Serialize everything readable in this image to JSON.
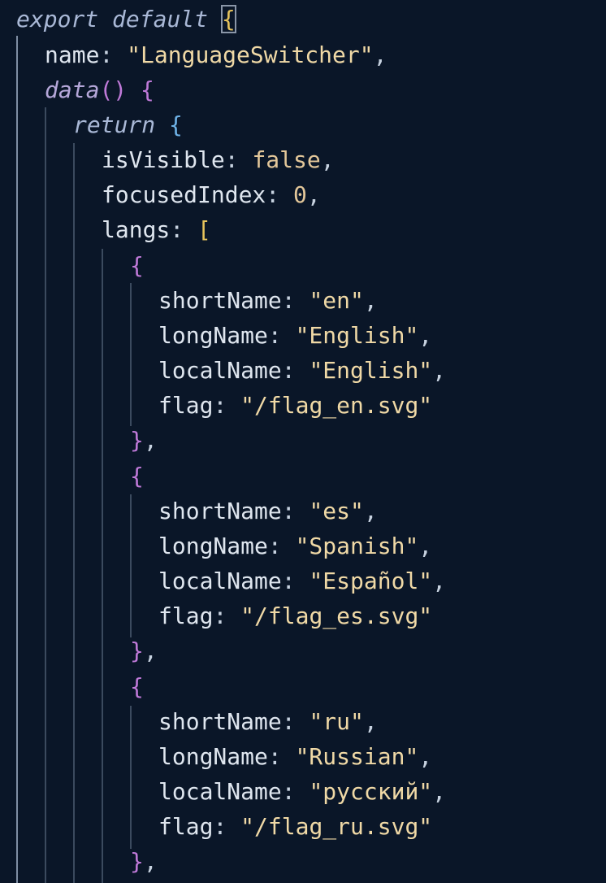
{
  "editor": {
    "theme": {
      "background": "#0a1628",
      "string_color": "#f0d9a6",
      "keyword_color": "#a9b8d6",
      "property_color": "#dfe6ef",
      "bracket_yellow": "#e6c35c",
      "bracket_purple": "#c07ad9",
      "bracket_blue": "#6fb3e8"
    },
    "code": {
      "export_kw": "export",
      "default_kw": "default",
      "open_brace": "{",
      "name_key": "name",
      "name_value": "\"LanguageSwitcher\"",
      "data_fn": "data",
      "data_parens": "()",
      "return_kw": "return",
      "is_visible_key": "isVisible",
      "is_visible_value": "false",
      "focused_index_key": "focusedIndex",
      "focused_index_value": "0",
      "langs_key": "langs",
      "langs_open": "[",
      "langs": [
        {
          "short_key": "shortName",
          "short_value": "\"en\"",
          "long_key": "longName",
          "long_value": "\"English\"",
          "local_key": "localName",
          "local_value": "\"English\"",
          "flag_key": "flag",
          "flag_value": "\"/flag_en.svg\""
        },
        {
          "short_key": "shortName",
          "short_value": "\"es\"",
          "long_key": "longName",
          "long_value": "\"Spanish\"",
          "local_key": "localName",
          "local_value": "\"Español\"",
          "flag_key": "flag",
          "flag_value": "\"/flag_es.svg\""
        },
        {
          "short_key": "shortName",
          "short_value": "\"ru\"",
          "long_key": "longName",
          "long_value": "\"Russian\"",
          "local_key": "localName",
          "local_value": "\"русский\"",
          "flag_key": "flag",
          "flag_value": "\"/flag_ru.svg\""
        }
      ]
    }
  }
}
